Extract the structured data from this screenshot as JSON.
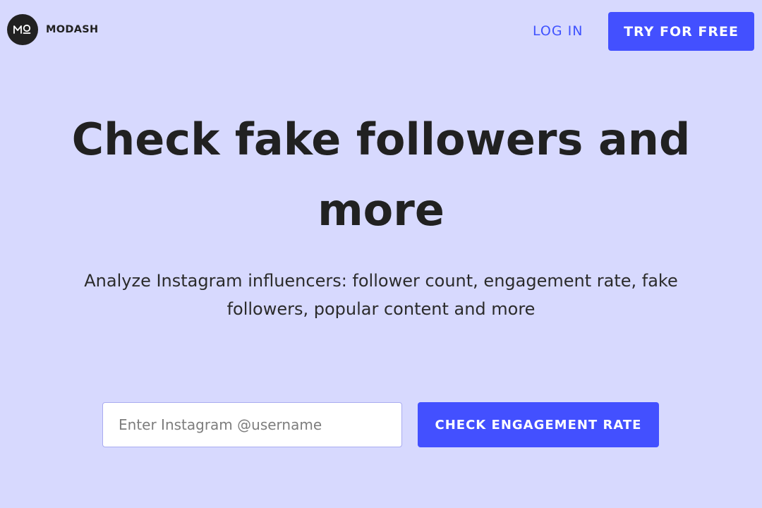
{
  "header": {
    "logo_mark": "MO",
    "logo_text": "MODASH",
    "login_label": "LOG IN",
    "try_label": "TRY FOR FREE"
  },
  "hero": {
    "title": "Check fake followers and more",
    "subtitle": "Analyze Instagram influencers: follower count, engagement rate, fake followers, popular content and more"
  },
  "search": {
    "placeholder": "Enter Instagram @username",
    "value": "",
    "button_label": "CHECK ENGAGEMENT RATE"
  },
  "colors": {
    "background": "#d7d9fe",
    "accent": "#4350ff",
    "text": "#212121"
  }
}
